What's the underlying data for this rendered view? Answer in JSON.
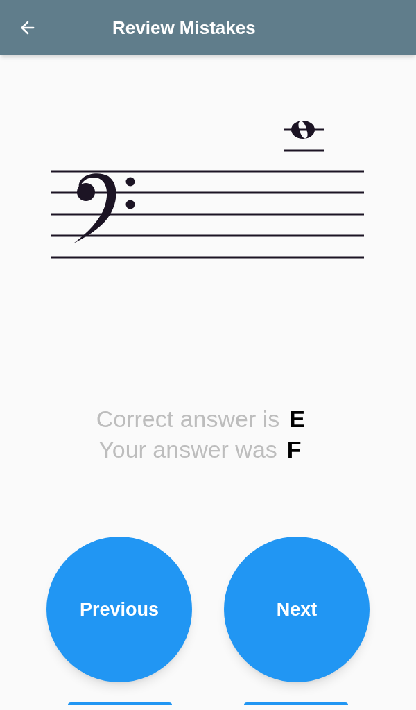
{
  "app_bar": {
    "title": "Review Mistakes"
  },
  "result": {
    "correct_label": "Correct answer is",
    "correct_value": "E",
    "given_label": "Your answer was",
    "given_value": "F"
  },
  "buttons": [
    {
      "label": "Previous"
    },
    {
      "label": "Next"
    }
  ]
}
